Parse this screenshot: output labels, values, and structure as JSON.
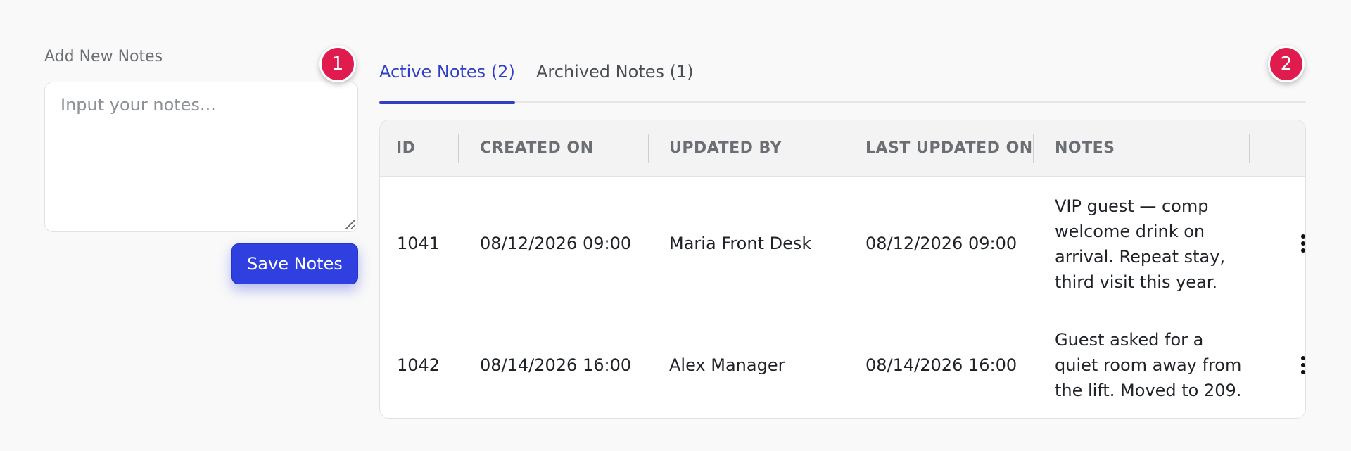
{
  "add_notes": {
    "label": "Add New Notes",
    "placeholder": "Input your notes...",
    "value": "",
    "save_label": "Save Notes"
  },
  "badges": {
    "step1": "1",
    "step2": "2"
  },
  "tabs": [
    {
      "label": "Active Notes (2)",
      "active": true
    },
    {
      "label": "Archived Notes (1)",
      "active": false
    }
  ],
  "table": {
    "columns": [
      "ID",
      "CREATED ON",
      "UPDATED BY",
      "LAST UPDATED ON",
      "NOTES"
    ],
    "rows": [
      {
        "id": "1041",
        "created_on": "08/12/2026 09:00",
        "updated_by": "Maria Front Desk",
        "last_updated_on": "08/12/2026 09:00",
        "notes": "VIP guest — comp welcome drink on arrival. Repeat stay, third visit this year."
      },
      {
        "id": "1042",
        "created_on": "08/14/2026 16:00",
        "updated_by": "Alex Manager",
        "last_updated_on": "08/14/2026 16:00",
        "notes": "Guest asked for a quiet room away from the lift. Moved to 209."
      }
    ]
  },
  "icons": {
    "row_menu": "kebab-menu-icon",
    "resize": "resize-handle-icon"
  },
  "colors": {
    "accent": "#2f3fc9",
    "button": "#2f3fe0",
    "badge": "#e01c4f"
  }
}
